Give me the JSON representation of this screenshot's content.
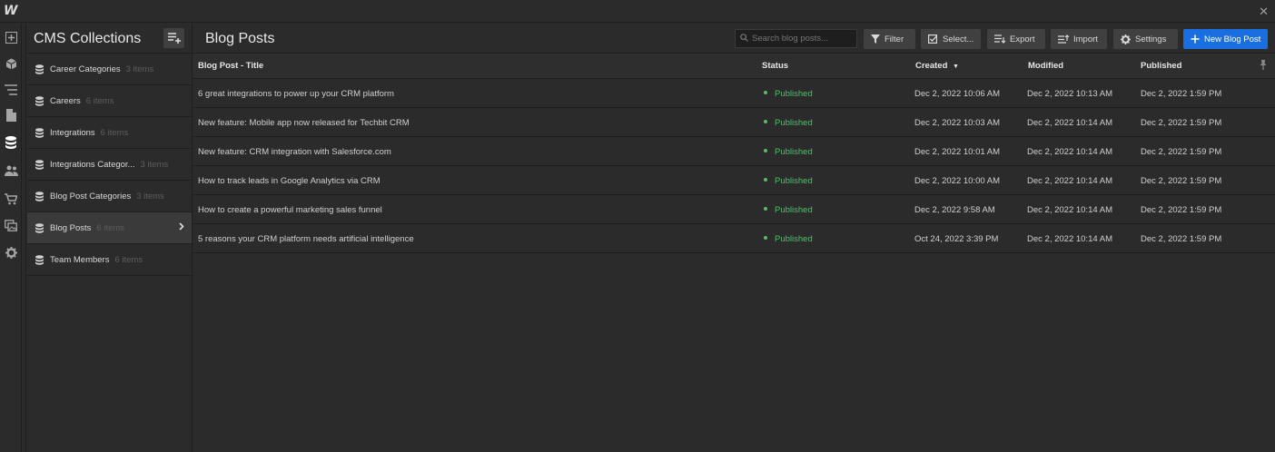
{
  "app": {
    "logo": "W"
  },
  "colors": {
    "accent": "#1a6fe0",
    "status_published": "#4fbf6a",
    "background": "#2b2b2b"
  },
  "rail": {
    "icons": [
      "add-panel-icon",
      "box-icon",
      "navigator-icon",
      "pages-icon",
      "cms-icon",
      "users-icon",
      "ecommerce-icon",
      "assets-icon",
      "settings-icon"
    ]
  },
  "cms": {
    "title": "CMS Collections",
    "collections": [
      {
        "name": "Career Categories",
        "count": "3 items"
      },
      {
        "name": "Careers",
        "count": "6 items"
      },
      {
        "name": "Integrations",
        "count": "6 items"
      },
      {
        "name": "Integrations Categor...",
        "count": "3 items"
      },
      {
        "name": "Blog Post Categories",
        "count": "3 items"
      },
      {
        "name": "Blog Posts",
        "count": "6 items"
      },
      {
        "name": "Team Members",
        "count": "6 items"
      }
    ]
  },
  "main": {
    "title": "Blog Posts",
    "search_placeholder": "Search blog posts...",
    "toolbar": {
      "filter": "Filter",
      "select": "Select...",
      "export": "Export",
      "import": "Import",
      "settings": "Settings",
      "new": "New Blog Post"
    },
    "columns": {
      "title": "Blog Post - Title",
      "status": "Status",
      "created": "Created",
      "modified": "Modified",
      "published": "Published"
    },
    "rows": [
      {
        "title": "6 great integrations to power up your CRM platform",
        "status": "Published",
        "created": "Dec 2, 2022 10:06 AM",
        "modified": "Dec 2, 2022 10:13 AM",
        "published": "Dec 2, 2022 1:59 PM"
      },
      {
        "title": "New feature: Mobile app now released for Techbit CRM",
        "status": "Published",
        "created": "Dec 2, 2022 10:03 AM",
        "modified": "Dec 2, 2022 10:14 AM",
        "published": "Dec 2, 2022 1:59 PM"
      },
      {
        "title": "New feature: CRM integration with Salesforce.com",
        "status": "Published",
        "created": "Dec 2, 2022 10:01 AM",
        "modified": "Dec 2, 2022 10:14 AM",
        "published": "Dec 2, 2022 1:59 PM"
      },
      {
        "title": "How to track leads in Google Analytics via CRM",
        "status": "Published",
        "created": "Dec 2, 2022 10:00 AM",
        "modified": "Dec 2, 2022 10:14 AM",
        "published": "Dec 2, 2022 1:59 PM"
      },
      {
        "title": "How to create a powerful marketing sales funnel",
        "status": "Published",
        "created": "Dec 2, 2022 9:58 AM",
        "modified": "Dec 2, 2022 10:14 AM",
        "published": "Dec 2, 2022 1:59 PM"
      },
      {
        "title": "5 reasons your CRM platform needs artificial intelligence",
        "status": "Published",
        "created": "Oct 24, 2022 3:39 PM",
        "modified": "Dec 2, 2022 10:14 AM",
        "published": "Dec 2, 2022 1:59 PM"
      }
    ]
  }
}
